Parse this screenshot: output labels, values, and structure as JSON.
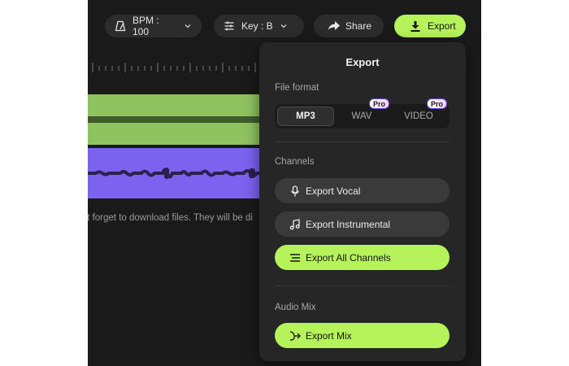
{
  "toolbar": {
    "bpm_label": "BPM : 100",
    "key_label": "Key : B",
    "share_label": "Share",
    "export_label": "Export"
  },
  "notice": {
    "text": "'t forget to download files. They will be di"
  },
  "export_panel": {
    "title": "Export",
    "file_format_label": "File format",
    "formats": [
      {
        "label": "MP3",
        "selected": true,
        "pro": ""
      },
      {
        "label": "WAV",
        "selected": false,
        "pro": "Pro"
      },
      {
        "label": "VIDEO",
        "selected": false,
        "pro": "Pro"
      }
    ],
    "channels_label": "Channels",
    "channel_buttons": [
      {
        "label": "Export Vocal",
        "icon": "microphone-icon"
      },
      {
        "label": "Export Instrumental",
        "icon": "music-note-icon"
      },
      {
        "label": "Export All Channels",
        "icon": "lines-icon"
      }
    ],
    "audio_mix_label": "Audio Mix",
    "mix_button_label": "Export Mix"
  },
  "colors": {
    "accent": "#b6f25a",
    "vocal_track": "#8ec35f",
    "instrumental_track": "#7b63f0",
    "panel_bg": "#262626"
  }
}
